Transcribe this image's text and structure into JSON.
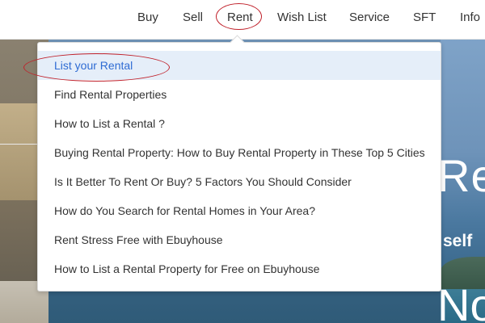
{
  "nav": {
    "items": [
      "Buy",
      "Sell",
      "Rent",
      "Wish List",
      "Service",
      "SFT",
      "Info"
    ]
  },
  "rent_menu": {
    "items": [
      "List your Rental",
      "Find Rental Properties",
      "How to List a Rental  ?",
      "Buying Rental Property: How to Buy Rental Property in These Top 5 Cities",
      "Is It Better To Rent Or Buy? 5 Factors You Should Consider",
      "How do You Search for Rental Homes in Your Area?",
      "Rent Stress Free with Ebuyhouse",
      "How to List a Rental Property for Free on Ebuyhouse"
    ]
  },
  "hero": {
    "heading_partial": "Re",
    "sub_partial": "self",
    "heading2_partial": "No"
  },
  "colors": {
    "accent_blue": "#2e6bd3",
    "active_bg": "#e5eef9",
    "annotation_red": "#c0202a"
  }
}
